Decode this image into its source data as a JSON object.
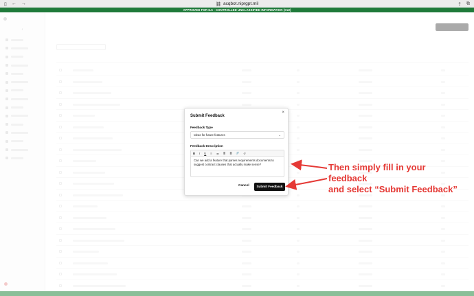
{
  "browser": {
    "url": "acqbot.niprgpt.mil",
    "nav_icons": [
      "sidebar-icon",
      "back-icon",
      "forward-icon"
    ],
    "right_icons": [
      "share-icon",
      "tabs-icon"
    ]
  },
  "banner": {
    "text": "APPROVED FOR IL5 - CONTROLLED UNCLASSIFIED INFORMATION (CUI)",
    "color": "#1f7a3a"
  },
  "modal": {
    "title": "Submit Feedback",
    "close_label": "×",
    "type_label": "Feedback Type",
    "type_value": "Ideas for future features",
    "description_label": "Feedback Description",
    "toolbar": [
      "B",
      "I",
      "U",
      "≡",
      "≔",
      "≣",
      "≣",
      "🔗",
      "↺"
    ],
    "description_text": "Can we add a feature that parses requirements documents to suggest contract clauses that actually make sense?",
    "cancel_label": "Cancel",
    "submit_label": "Submit Feedback"
  },
  "annotation": {
    "line1": "Then simply fill in your feedback",
    "line2": "and select “Submit Feedback”",
    "color": "#e53935"
  }
}
